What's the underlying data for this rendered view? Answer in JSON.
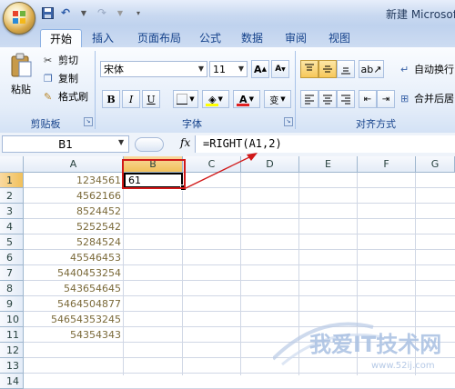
{
  "titlebar": {
    "app_title": "新建 Microsoft"
  },
  "tabs": [
    "开始",
    "插入",
    "页面布局",
    "公式",
    "数据",
    "审阅",
    "视图"
  ],
  "clipboard": {
    "paste": "粘贴",
    "cut": "剪切",
    "copy": "复制",
    "format_painter": "格式刷",
    "group": "剪贴板"
  },
  "font": {
    "name": "宋体",
    "size": "11",
    "group": "字体",
    "bold": "B",
    "italic": "I",
    "underline": "U",
    "grow": "A",
    "shrink": "A",
    "color": "A",
    "wen": "变"
  },
  "alignment": {
    "wrap": "自动换行",
    "merge": "合并后居",
    "group": "对齐方式"
  },
  "formula_bar": {
    "name_box": "B1",
    "fx": "fx",
    "formula": "=RIGHT(A1,2)"
  },
  "columns": [
    "A",
    "B",
    "C",
    "D",
    "E",
    "F",
    "G"
  ],
  "rows": [
    "1",
    "2",
    "3",
    "4",
    "5",
    "6",
    "7",
    "8",
    "9",
    "10",
    "11",
    "12",
    "13",
    "14"
  ],
  "cells_a": [
    "1234561",
    "4562166",
    "8524452",
    "5252542",
    "5284524",
    "45546453",
    "5440453254",
    "543654645",
    "5464504877",
    "54654353245",
    "54354343"
  ],
  "cell_b1": "61",
  "watermark": {
    "text": "我爱IT技术网",
    "url": "www.52ij.com"
  },
  "colors": {
    "accent": "#15428b",
    "highlight_red": "#d01818",
    "selected_header": "#f1c05a"
  }
}
